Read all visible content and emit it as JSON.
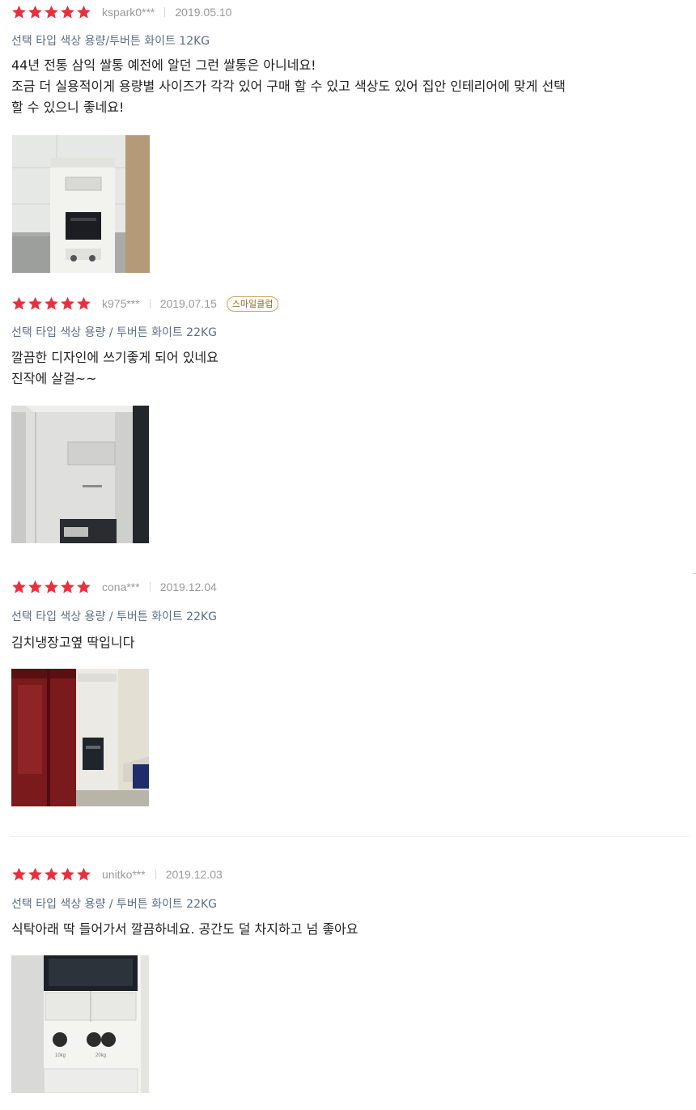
{
  "rating_color": "#e5313f",
  "reviews": [
    {
      "rating": 5,
      "user": "kspark0***",
      "date": "2019.05.10",
      "option": "선택 타입 색상 용량/투버튼 화이트 12KG",
      "lines": [
        "44년 전통 삼익 쌀통 예전에 알던 그런 쌀통은 아니네요!",
        "조금 더 실용적이게 용량별 사이즈가 각각 있어 구매 할 수 있고 색상도 있어 집안 인테리어에 맞게 선택",
        "할 수 있으니 좋네요!"
      ],
      "photo": "review-photo"
    },
    {
      "rating": 5,
      "user": "k975***",
      "date": "2019.07.15",
      "badge": "스마일클럽",
      "option": "선택 타입 색상 용량 / 투버튼 화이트 22KG",
      "lines": [
        "깔끔한 디자인에 쓰기좋게 되어 있네요",
        "진작에 살걸~~"
      ],
      "photo": "review-photo"
    },
    {
      "rating": 5,
      "user": "cona***",
      "date": "2019.12.04",
      "option": "선택 타입 색상 용량 / 투버튼 화이트 22KG",
      "lines": [
        "김치냉장고옆 딱입니다"
      ],
      "photo": "review-photo"
    },
    {
      "rating": 5,
      "user": "unitko***",
      "date": "2019.12.03",
      "option": "선택 타입 색상 용량 / 투버튼 화이트 22KG",
      "lines": [
        "식탁아래 딱 들어가서 깔끔하네요. 공간도 덜 차지하고 넘 좋아요"
      ],
      "photo": "review-photo",
      "photo_labels": [
        "10kg",
        "20kg"
      ]
    }
  ]
}
